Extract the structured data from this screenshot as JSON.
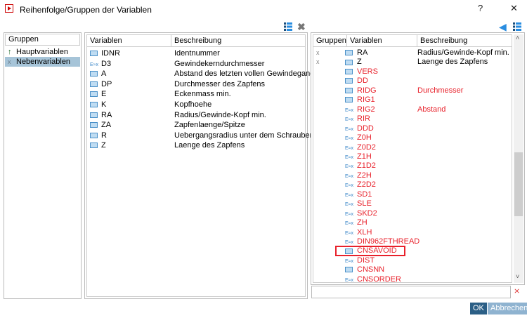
{
  "window": {
    "title": "Reihenfolge/Gruppen der Variablen",
    "help": "?",
    "close": "✕"
  },
  "groups": {
    "header": "Gruppen",
    "items": [
      {
        "label": "Hauptvariablen",
        "icon": "pin-icon"
      },
      {
        "label": "Nebenvariablen",
        "icon": "x-icon",
        "selected": true
      }
    ]
  },
  "left_table": {
    "headers": [
      "Variablen",
      "Beschreibung"
    ],
    "rows": [
      {
        "var": "IDNR",
        "desc": "Identnummer",
        "icon": "table"
      },
      {
        "var": "D3",
        "desc": "Gewindekerndurchmesser",
        "icon": "formula"
      },
      {
        "var": "A",
        "desc": "Abstand des letzten vollen Gewindeganges...",
        "icon": "table"
      },
      {
        "var": "DP",
        "desc": "Durchmesser des Zapfens",
        "icon": "table"
      },
      {
        "var": "E",
        "desc": "Eckenmass min.",
        "icon": "table"
      },
      {
        "var": "K",
        "desc": "Kopfhoehe",
        "icon": "table"
      },
      {
        "var": "RA",
        "desc": "Radius/Gewinde-Kopf min.",
        "icon": "table"
      },
      {
        "var": "ZA",
        "desc": "Zapfenlaenge/Spitze",
        "icon": "table"
      },
      {
        "var": "R",
        "desc": "Uebergangsradius unter dem Schraubenko...",
        "icon": "table"
      },
      {
        "var": "Z",
        "desc": "Laenge des Zapfens",
        "icon": "table"
      }
    ]
  },
  "right_table": {
    "headers": [
      "Gruppen",
      "Variablen",
      "Beschreibung"
    ],
    "rows": [
      {
        "grp": "x",
        "var": "RA",
        "desc": "Radius/Gewinde-Kopf min.",
        "icon": "table",
        "red": false
      },
      {
        "grp": "x",
        "var": "Z",
        "desc": "Laenge des Zapfens",
        "icon": "table",
        "red": false
      },
      {
        "grp": "",
        "var": "VERS",
        "desc": "",
        "icon": "table",
        "red": true
      },
      {
        "grp": "",
        "var": "DD",
        "desc": "",
        "icon": "table",
        "red": true
      },
      {
        "grp": "",
        "var": "RIDG",
        "desc": "Durchmesser",
        "icon": "table",
        "red": true
      },
      {
        "grp": "",
        "var": "RIG1",
        "desc": "",
        "icon": "table",
        "red": true
      },
      {
        "grp": "",
        "var": "RIG2",
        "desc": "Abstand",
        "icon": "formula",
        "red": true
      },
      {
        "grp": "",
        "var": "RIR",
        "desc": "",
        "icon": "formula",
        "red": true
      },
      {
        "grp": "",
        "var": "DDD",
        "desc": "",
        "icon": "formula",
        "red": true
      },
      {
        "grp": "",
        "var": "Z0H",
        "desc": "",
        "icon": "formula",
        "red": true
      },
      {
        "grp": "",
        "var": "Z0D2",
        "desc": "",
        "icon": "formula",
        "red": true
      },
      {
        "grp": "",
        "var": "Z1H",
        "desc": "",
        "icon": "formula",
        "red": true
      },
      {
        "grp": "",
        "var": "Z1D2",
        "desc": "",
        "icon": "formula",
        "red": true
      },
      {
        "grp": "",
        "var": "Z2H",
        "desc": "",
        "icon": "formula",
        "red": true
      },
      {
        "grp": "",
        "var": "Z2D2",
        "desc": "",
        "icon": "formula",
        "red": true
      },
      {
        "grp": "",
        "var": "SD1",
        "desc": "",
        "icon": "formula",
        "red": true
      },
      {
        "grp": "",
        "var": "SLE",
        "desc": "",
        "icon": "formula",
        "red": true
      },
      {
        "grp": "",
        "var": "SKD2",
        "desc": "",
        "icon": "formula",
        "red": true
      },
      {
        "grp": "",
        "var": "ZH",
        "desc": "",
        "icon": "formula",
        "red": true
      },
      {
        "grp": "",
        "var": "XLH",
        "desc": "",
        "icon": "formula",
        "red": true
      },
      {
        "grp": "",
        "var": "DIN962FTHREAD",
        "desc": "",
        "icon": "formula",
        "red": true
      },
      {
        "grp": "",
        "var": "CNSAVOID",
        "desc": "",
        "icon": "table",
        "red": true,
        "highlighted": true
      },
      {
        "grp": "",
        "var": "DIST",
        "desc": "",
        "icon": "formula",
        "red": true
      },
      {
        "grp": "",
        "var": "CNSNN",
        "desc": "",
        "icon": "table",
        "red": true
      },
      {
        "grp": "",
        "var": "CNSORDER",
        "desc": "",
        "icon": "formula",
        "red": true
      }
    ]
  },
  "filter": {
    "value": ""
  },
  "buttons": {
    "ok": "OK",
    "cancel": "Abbrechen"
  },
  "icons": {
    "formula_glyph": "E≈x"
  },
  "colors": {
    "red_text": "#e8212b",
    "ok_bg": "#2b5f86",
    "cancel_bg": "#8fb3d0",
    "selection": "#a6c4d8"
  }
}
